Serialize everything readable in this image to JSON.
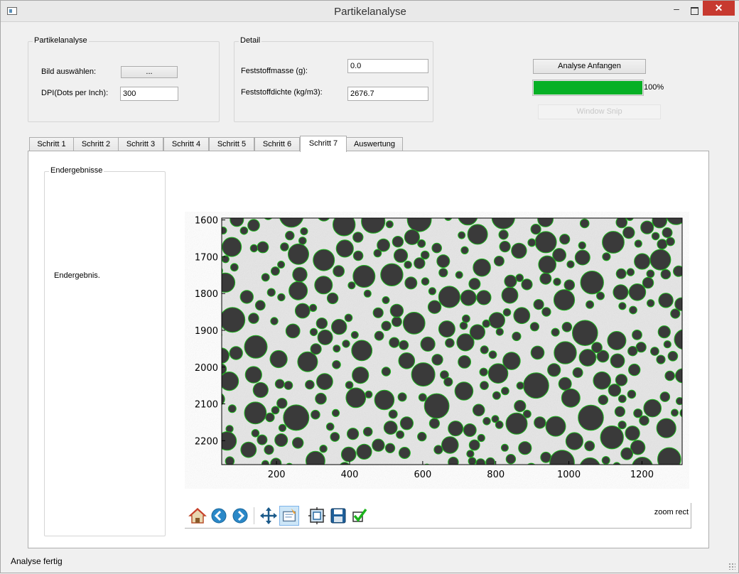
{
  "window": {
    "title": "Partikelanalyse",
    "minimize": "–",
    "close": "✕"
  },
  "groups": {
    "partikel": {
      "title": "Partikelanalyse",
      "bild_label": "Bild auswählen:",
      "browse_label": "...",
      "dpi_label": "DPI(Dots per Inch):",
      "dpi_value": "300"
    },
    "detail": {
      "title": "Detail",
      "masse_label": "Feststoffmasse (g):",
      "masse_value": "0.0",
      "dichte_label": "Feststoffdichte (kg/m3):",
      "dichte_value": "2676.7"
    }
  },
  "actions": {
    "start_label": "Analyse Anfangen",
    "progress_value": 100,
    "progress_text": "100%",
    "snip_label": "Window Snip"
  },
  "tabs": [
    {
      "label": "Schritt 1"
    },
    {
      "label": "Schritt 2"
    },
    {
      "label": "Schritt 3"
    },
    {
      "label": "Schritt 4"
    },
    {
      "label": "Schritt 5"
    },
    {
      "label": "Schritt 6"
    },
    {
      "label": "Schritt 7"
    },
    {
      "label": "Auswertung"
    }
  ],
  "active_tab": "Schritt 7",
  "results": {
    "title": "Endergebnisse",
    "text": "Endergebnis."
  },
  "plot": {
    "x_ticks": [
      "200",
      "400",
      "600",
      "800",
      "1000",
      "1200"
    ],
    "y_ticks": [
      "1600",
      "1700",
      "1800",
      "1900",
      "2000",
      "2100",
      "2200"
    ],
    "x_range": [
      50,
      1310
    ],
    "y_range": [
      1595,
      2265
    ],
    "particle_color": "#3a3a3a",
    "outline_color": "#1db41d",
    "background_color": "#e6e6e6"
  },
  "toolbar": {
    "icons": [
      "home-icon",
      "back-icon",
      "forward-icon",
      "pan-icon",
      "zoom-rect-icon",
      "subplots-icon",
      "save-icon",
      "check-icon"
    ],
    "mode_text": "zoom rect"
  },
  "status": {
    "text": "Analyse fertig"
  }
}
